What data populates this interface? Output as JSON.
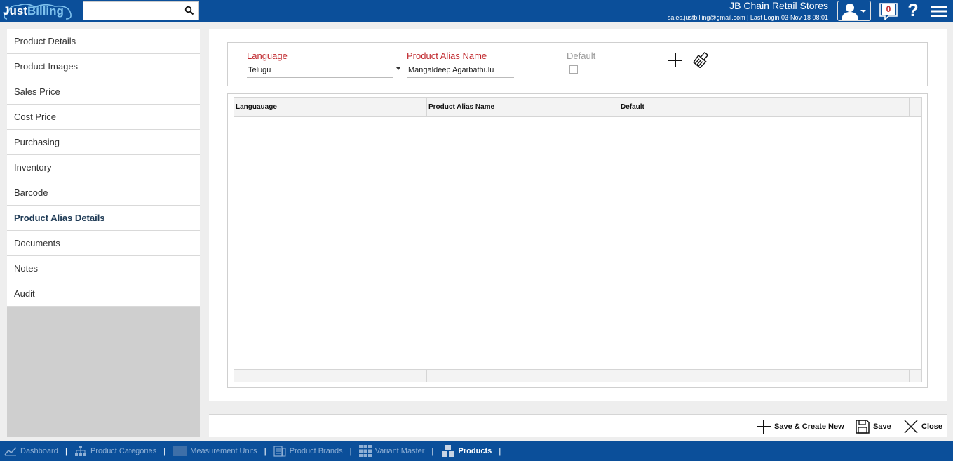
{
  "app": {
    "logo_main": "Just",
    "logo_accent": "Billing",
    "search": {
      "value": "",
      "placeholder": ""
    },
    "store_name": "JB Chain Retail Stores",
    "user_info": "sales.justbilling@gmail.com | Last Login 03-Nov-18 08:01",
    "notification_count": "0",
    "help_label": "?"
  },
  "sidebar": {
    "items": [
      {
        "label": "Product Details",
        "active": false
      },
      {
        "label": "Product Images",
        "active": false
      },
      {
        "label": "Sales Price",
        "active": false
      },
      {
        "label": "Cost Price",
        "active": false
      },
      {
        "label": "Purchasing",
        "active": false
      },
      {
        "label": "Inventory",
        "active": false
      },
      {
        "label": "Barcode",
        "active": false
      },
      {
        "label": "Product Alias Details",
        "active": true
      },
      {
        "label": "Documents",
        "active": false
      },
      {
        "label": "Notes",
        "active": false
      },
      {
        "label": "Audit",
        "active": false
      }
    ]
  },
  "form": {
    "language_label": "Language",
    "language_value": "Telugu",
    "alias_label": "Product Alias Name",
    "alias_value": "Mangaldeep Agarbathulu",
    "default_label": "Default",
    "default_checked": false
  },
  "grid": {
    "columns": [
      "Languauage",
      "Product Alias Name",
      "Default",
      ""
    ],
    "rows": []
  },
  "actions": {
    "save_create_new": "Save & Create New",
    "save": "Save",
    "close": "Close"
  },
  "bottom_tabs": [
    {
      "label": "Dashboard",
      "icon": "chart-icon",
      "active": false
    },
    {
      "label": "Product Categories",
      "icon": "hierarchy-icon",
      "active": false
    },
    {
      "label": "Measurement Units",
      "icon": "units-icon",
      "active": false
    },
    {
      "label": "Product Brands",
      "icon": "brands-icon",
      "active": false
    },
    {
      "label": "Variant Master",
      "icon": "grid-icon",
      "active": false
    },
    {
      "label": "Products",
      "icon": "boxes-icon",
      "active": true
    }
  ],
  "colors": {
    "brand": "#0b4f9a",
    "required_label": "#c0282d",
    "sidebar_fill": "#cfcfcf"
  }
}
